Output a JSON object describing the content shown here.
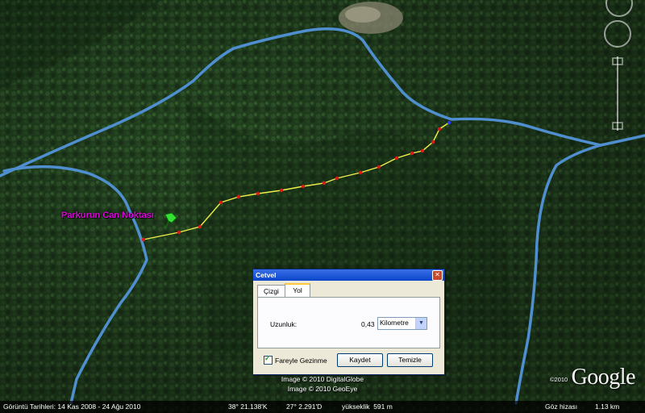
{
  "map": {
    "placemark_label": "Parkurun Can Noktası",
    "credit_line1": "Image © 2010 DigitalGlobe",
    "credit_line2": "Image © 2010 GeoEye",
    "logo_year": "©2010",
    "logo_text": "Google",
    "colors": {
      "road": "#4f8fd0",
      "path": "#f0f04a",
      "waypoint": "#dd1a1a",
      "endpoint": "#2a3cff",
      "placemark": "#35e035",
      "label": "#e000e0"
    }
  },
  "status_bar": {
    "dates": "Görüntü Tarihleri: 14 Kas 2008 - 24 Ağu 2010",
    "lat": "38° 21.138'K",
    "lon": "27° 2.291'D",
    "elevation": "yükseklik  591 m",
    "eye_alt_label": "Göz hizası",
    "eye_alt_value": "1.13 km"
  },
  "ruler_dialog": {
    "title": "Cetvel",
    "tabs": [
      "Çizgi",
      "Yol"
    ],
    "active_tab": "Yol",
    "length_label": "Uzunluk:",
    "length_value": "0,43",
    "unit": "Kilometre",
    "mouse_nav_label": "Fareyle Gezinme",
    "mouse_nav_checked": true,
    "save_button": "Kaydet",
    "clear_button": "Temizle"
  }
}
